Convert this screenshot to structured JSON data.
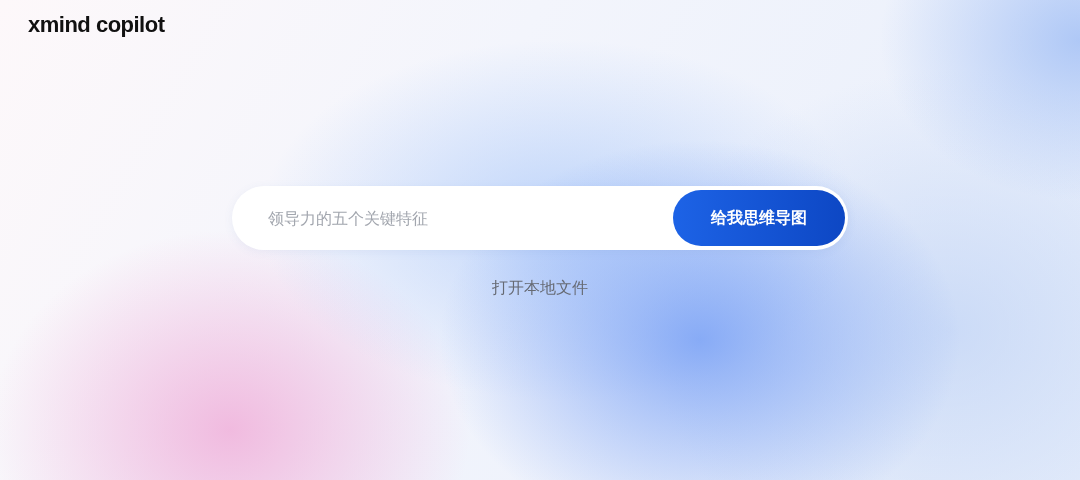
{
  "logo": {
    "text": "xmind copilot"
  },
  "prompt": {
    "placeholder": "领导力的五个关键特征"
  },
  "submit_button": {
    "label": "给我思维导图"
  },
  "open_file_link": {
    "label": "打开本地文件"
  }
}
